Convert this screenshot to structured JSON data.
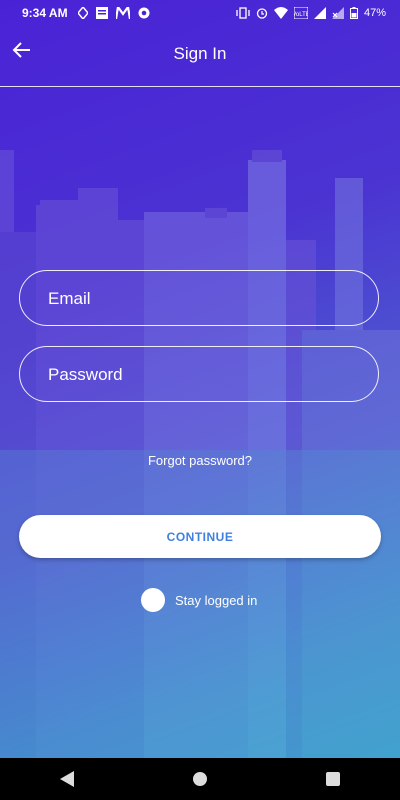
{
  "status_bar": {
    "time": "9:34 AM",
    "battery": "47%",
    "left_icons": [
      "data-saver-icon",
      "news-icon",
      "m-app-icon",
      "chrome-icon"
    ],
    "right_icons": [
      "vibrate-icon",
      "alarm-icon",
      "wifi-icon",
      "volte-icon",
      "signal-icon",
      "signal-x-icon",
      "battery-icon"
    ]
  },
  "app_bar": {
    "title": "Sign In",
    "back_icon": "back-arrow-icon"
  },
  "form": {
    "email_placeholder": "Email",
    "password_placeholder": "Password",
    "forgot_password": "Forgot password?",
    "continue_label": "CONTINUE",
    "stay_logged_in": "Stay logged in"
  },
  "nav_bar": {
    "icons": [
      "back-triangle-icon",
      "home-circle-icon",
      "recents-square-icon"
    ]
  },
  "colors": {
    "gradient_top": "#4a22d6",
    "gradient_bottom": "#15c2c2",
    "button_text": "#3f7fe0"
  }
}
